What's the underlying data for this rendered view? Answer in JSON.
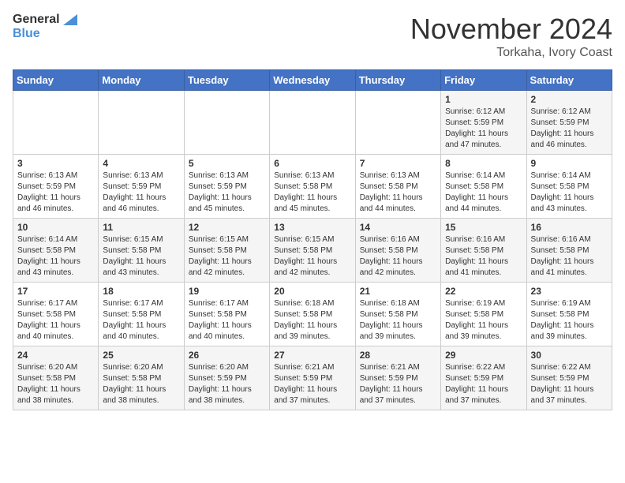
{
  "header": {
    "logo_line1": "General",
    "logo_line2": "Blue",
    "month": "November 2024",
    "location": "Torkaha, Ivory Coast"
  },
  "weekdays": [
    "Sunday",
    "Monday",
    "Tuesday",
    "Wednesday",
    "Thursday",
    "Friday",
    "Saturday"
  ],
  "weeks": [
    [
      {
        "day": "",
        "info": ""
      },
      {
        "day": "",
        "info": ""
      },
      {
        "day": "",
        "info": ""
      },
      {
        "day": "",
        "info": ""
      },
      {
        "day": "",
        "info": ""
      },
      {
        "day": "1",
        "info": "Sunrise: 6:12 AM\nSunset: 5:59 PM\nDaylight: 11 hours and 47 minutes."
      },
      {
        "day": "2",
        "info": "Sunrise: 6:12 AM\nSunset: 5:59 PM\nDaylight: 11 hours and 46 minutes."
      }
    ],
    [
      {
        "day": "3",
        "info": "Sunrise: 6:13 AM\nSunset: 5:59 PM\nDaylight: 11 hours and 46 minutes."
      },
      {
        "day": "4",
        "info": "Sunrise: 6:13 AM\nSunset: 5:59 PM\nDaylight: 11 hours and 46 minutes."
      },
      {
        "day": "5",
        "info": "Sunrise: 6:13 AM\nSunset: 5:59 PM\nDaylight: 11 hours and 45 minutes."
      },
      {
        "day": "6",
        "info": "Sunrise: 6:13 AM\nSunset: 5:58 PM\nDaylight: 11 hours and 45 minutes."
      },
      {
        "day": "7",
        "info": "Sunrise: 6:13 AM\nSunset: 5:58 PM\nDaylight: 11 hours and 44 minutes."
      },
      {
        "day": "8",
        "info": "Sunrise: 6:14 AM\nSunset: 5:58 PM\nDaylight: 11 hours and 44 minutes."
      },
      {
        "day": "9",
        "info": "Sunrise: 6:14 AM\nSunset: 5:58 PM\nDaylight: 11 hours and 43 minutes."
      }
    ],
    [
      {
        "day": "10",
        "info": "Sunrise: 6:14 AM\nSunset: 5:58 PM\nDaylight: 11 hours and 43 minutes."
      },
      {
        "day": "11",
        "info": "Sunrise: 6:15 AM\nSunset: 5:58 PM\nDaylight: 11 hours and 43 minutes."
      },
      {
        "day": "12",
        "info": "Sunrise: 6:15 AM\nSunset: 5:58 PM\nDaylight: 11 hours and 42 minutes."
      },
      {
        "day": "13",
        "info": "Sunrise: 6:15 AM\nSunset: 5:58 PM\nDaylight: 11 hours and 42 minutes."
      },
      {
        "day": "14",
        "info": "Sunrise: 6:16 AM\nSunset: 5:58 PM\nDaylight: 11 hours and 42 minutes."
      },
      {
        "day": "15",
        "info": "Sunrise: 6:16 AM\nSunset: 5:58 PM\nDaylight: 11 hours and 41 minutes."
      },
      {
        "day": "16",
        "info": "Sunrise: 6:16 AM\nSunset: 5:58 PM\nDaylight: 11 hours and 41 minutes."
      }
    ],
    [
      {
        "day": "17",
        "info": "Sunrise: 6:17 AM\nSunset: 5:58 PM\nDaylight: 11 hours and 40 minutes."
      },
      {
        "day": "18",
        "info": "Sunrise: 6:17 AM\nSunset: 5:58 PM\nDaylight: 11 hours and 40 minutes."
      },
      {
        "day": "19",
        "info": "Sunrise: 6:17 AM\nSunset: 5:58 PM\nDaylight: 11 hours and 40 minutes."
      },
      {
        "day": "20",
        "info": "Sunrise: 6:18 AM\nSunset: 5:58 PM\nDaylight: 11 hours and 39 minutes."
      },
      {
        "day": "21",
        "info": "Sunrise: 6:18 AM\nSunset: 5:58 PM\nDaylight: 11 hours and 39 minutes."
      },
      {
        "day": "22",
        "info": "Sunrise: 6:19 AM\nSunset: 5:58 PM\nDaylight: 11 hours and 39 minutes."
      },
      {
        "day": "23",
        "info": "Sunrise: 6:19 AM\nSunset: 5:58 PM\nDaylight: 11 hours and 39 minutes."
      }
    ],
    [
      {
        "day": "24",
        "info": "Sunrise: 6:20 AM\nSunset: 5:58 PM\nDaylight: 11 hours and 38 minutes."
      },
      {
        "day": "25",
        "info": "Sunrise: 6:20 AM\nSunset: 5:58 PM\nDaylight: 11 hours and 38 minutes."
      },
      {
        "day": "26",
        "info": "Sunrise: 6:20 AM\nSunset: 5:59 PM\nDaylight: 11 hours and 38 minutes."
      },
      {
        "day": "27",
        "info": "Sunrise: 6:21 AM\nSunset: 5:59 PM\nDaylight: 11 hours and 37 minutes."
      },
      {
        "day": "28",
        "info": "Sunrise: 6:21 AM\nSunset: 5:59 PM\nDaylight: 11 hours and 37 minutes."
      },
      {
        "day": "29",
        "info": "Sunrise: 6:22 AM\nSunset: 5:59 PM\nDaylight: 11 hours and 37 minutes."
      },
      {
        "day": "30",
        "info": "Sunrise: 6:22 AM\nSunset: 5:59 PM\nDaylight: 11 hours and 37 minutes."
      }
    ]
  ]
}
